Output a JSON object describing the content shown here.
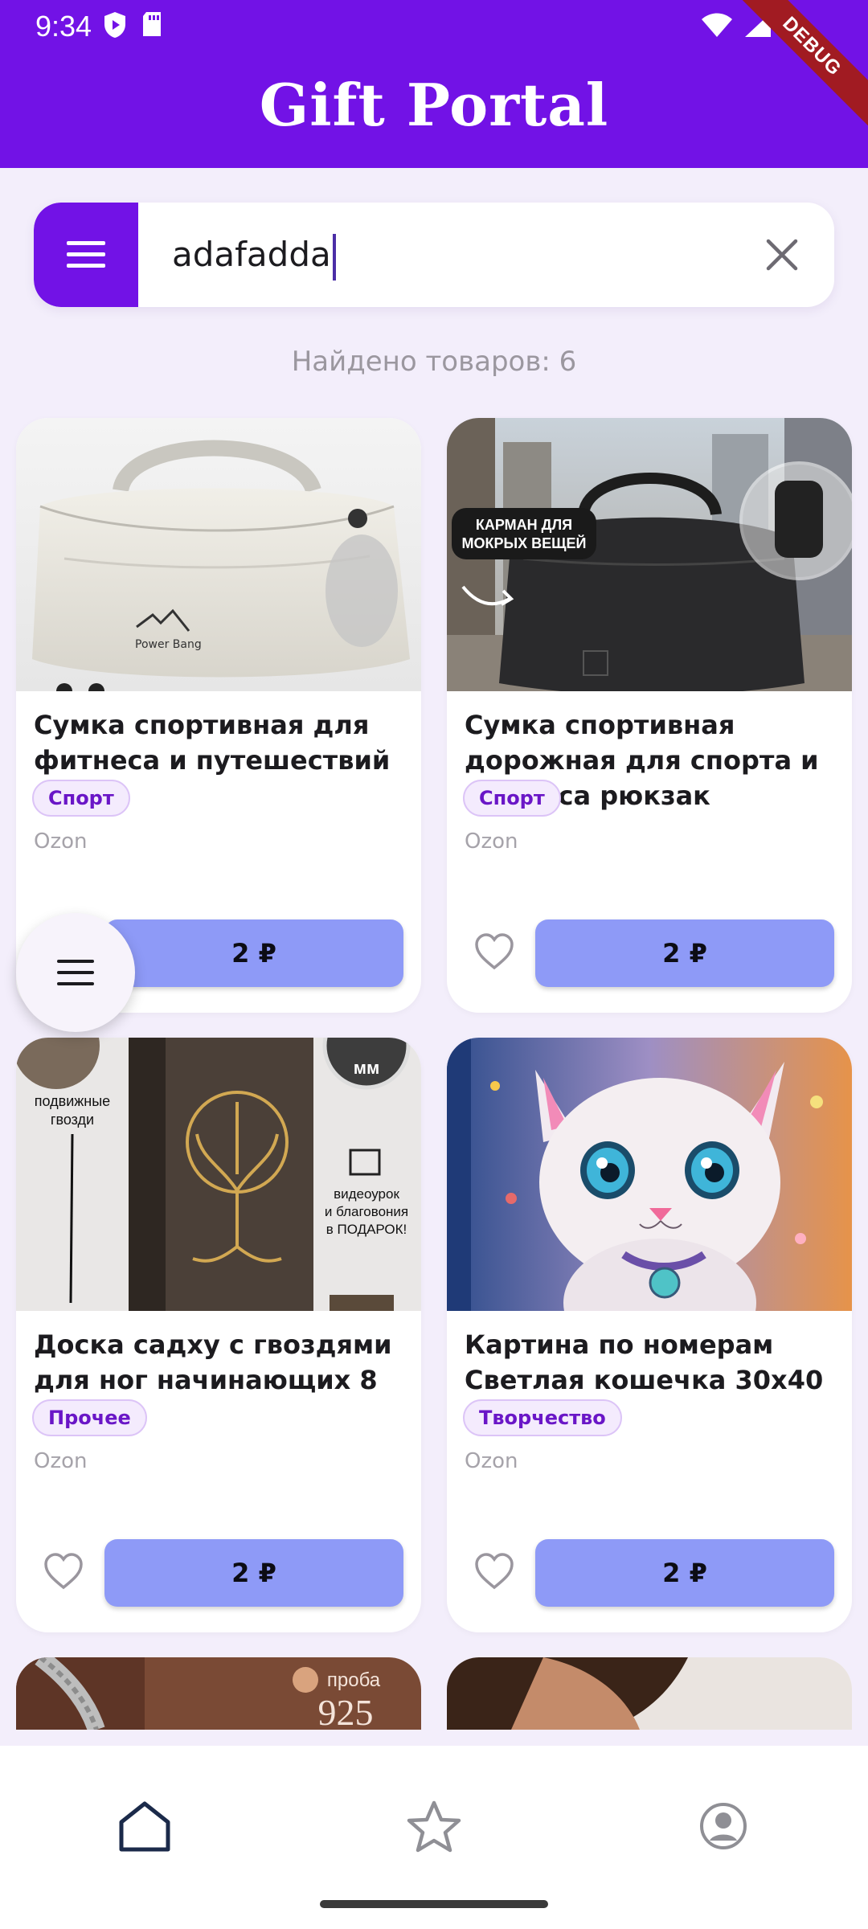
{
  "status_bar": {
    "time": "9:34",
    "debug_label": "DEBUG"
  },
  "app": {
    "title": "Gift Portal"
  },
  "search": {
    "value": "adafadda"
  },
  "results": {
    "count_text": "Найдено товаров: 6"
  },
  "products": [
    {
      "title": "Сумка спортивная для фитнеса и путешествий",
      "category": "Спорт",
      "shop": "Ozon",
      "price": "2 ₽",
      "image_desc": "white-sports-bag",
      "brand_mark": "Power Bang"
    },
    {
      "title": "Сумка спортивная дорожная для спорта и фитнеса рюкзак",
      "category": "Спорт",
      "shop": "Ozon",
      "price": "2 ₽",
      "image_desc": "black-travel-bag",
      "image_caption": "КАРМАН ДЛЯ МОКРЫХ ВЕЩЕЙ"
    },
    {
      "title": "Доска садху с гвоздями для ног начинающих 8 мм",
      "category": "Прочее",
      "shop": "Ozon",
      "price": "2 ₽",
      "image_desc": "sadhu-board",
      "image_caption_left": "подвижные гвозди",
      "image_caption_right": "видеоурок и благовония в ПОДАРОК!",
      "image_badge": "мм"
    },
    {
      "title": "Картина по номерам Светлая кошечка 30х40",
      "category": "Творчество",
      "shop": "Ozon",
      "price": "2 ₽",
      "image_desc": "kitten-painting"
    },
    {
      "image_desc": "silver-bracelet",
      "image_caption": "проба",
      "image_number": "925"
    },
    {
      "image_desc": "earring-portrait"
    }
  ],
  "nav": {
    "items": [
      "home-icon",
      "star-icon",
      "profile-icon"
    ]
  },
  "colors": {
    "primary": "#7212e6",
    "price_button": "#8e9af7",
    "background": "#f3eefb"
  }
}
